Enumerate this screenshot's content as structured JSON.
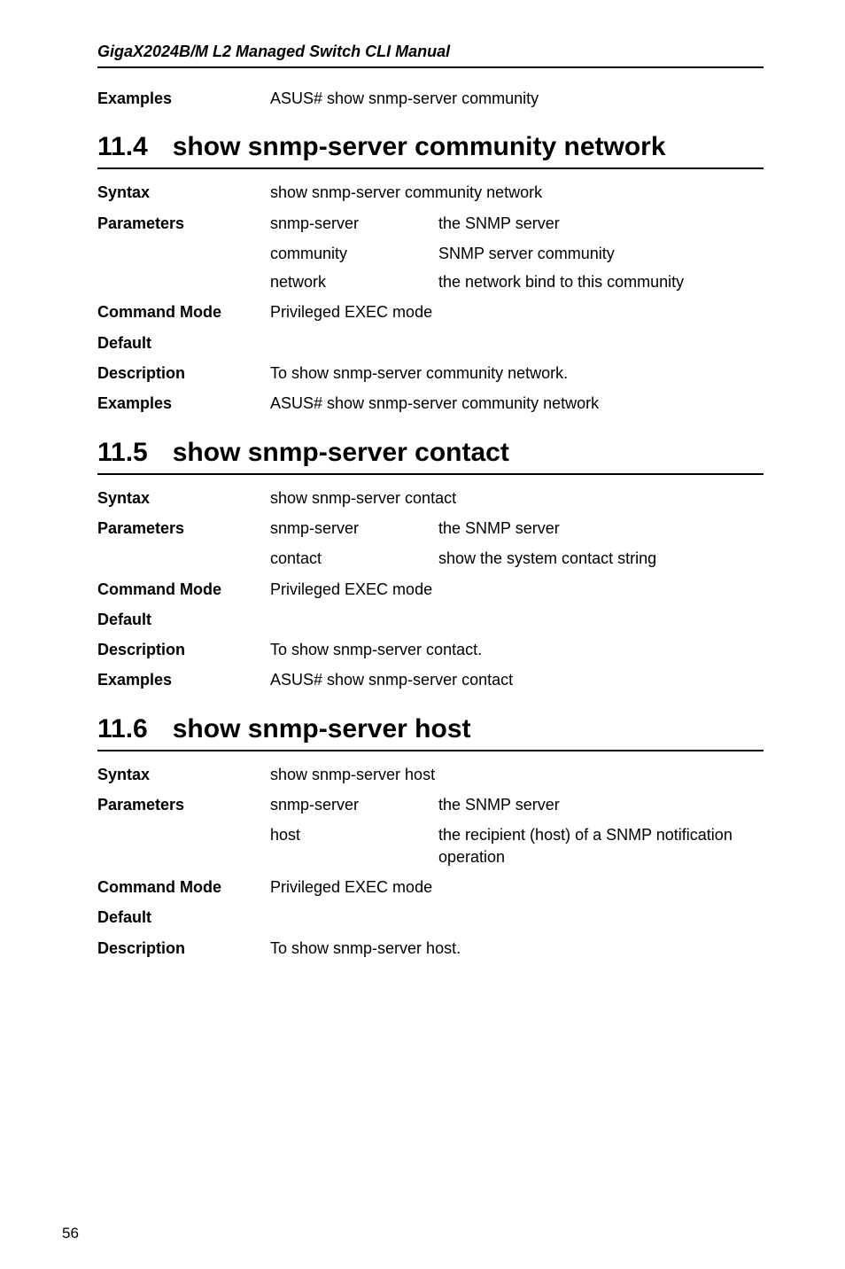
{
  "header": "GigaX2024B/M L2 Managed Switch CLI Manual",
  "examples_top": {
    "label": "Examples",
    "value": "ASUS# show snmp-server community"
  },
  "section_11_4": {
    "number": "11.4",
    "title": "show snmp-server community network",
    "syntax": {
      "label": "Syntax",
      "value": "show snmp-server community network"
    },
    "parameters_label": "Parameters",
    "parameters": [
      {
        "name": "snmp-server",
        "desc": "the SNMP server"
      },
      {
        "name": "community",
        "desc": "SNMP server community"
      },
      {
        "name": "network",
        "desc": "the network bind to this community"
      }
    ],
    "command_mode": {
      "label": "Command Mode",
      "value": "Privileged EXEC mode"
    },
    "default": {
      "label": "Default",
      "value": ""
    },
    "description": {
      "label": "Description",
      "value": "To show snmp-server community network."
    },
    "examples": {
      "label": "Examples",
      "value": "ASUS# show snmp-server community network"
    }
  },
  "section_11_5": {
    "number": "11.5",
    "title": "show snmp-server contact",
    "syntax": {
      "label": "Syntax",
      "value": "show snmp-server contact"
    },
    "parameters_label": "Parameters",
    "parameters": [
      {
        "name": "snmp-server",
        "desc": "the SNMP server"
      },
      {
        "name": "contact",
        "desc": "show the system contact string"
      }
    ],
    "command_mode": {
      "label": "Command Mode",
      "value": "Privileged EXEC mode"
    },
    "default": {
      "label": "Default",
      "value": ""
    },
    "description": {
      "label": "Description",
      "value": "To show snmp-server contact."
    },
    "examples": {
      "label": "Examples",
      "value": "ASUS# show snmp-server contact"
    }
  },
  "section_11_6": {
    "number": "11.6",
    "title": "show snmp-server host",
    "syntax": {
      "label": "Syntax",
      "value": "show snmp-server host"
    },
    "parameters_label": "Parameters",
    "parameters": [
      {
        "name": "snmp-server",
        "desc": "the SNMP server"
      },
      {
        "name": "host",
        "desc": "the recipient (host) of a SNMP notification operation"
      }
    ],
    "command_mode": {
      "label": "Command Mode",
      "value": "Privileged EXEC mode"
    },
    "default": {
      "label": "Default",
      "value": ""
    },
    "description": {
      "label": "Description",
      "value": "To show snmp-server host."
    }
  },
  "page_number": "56"
}
